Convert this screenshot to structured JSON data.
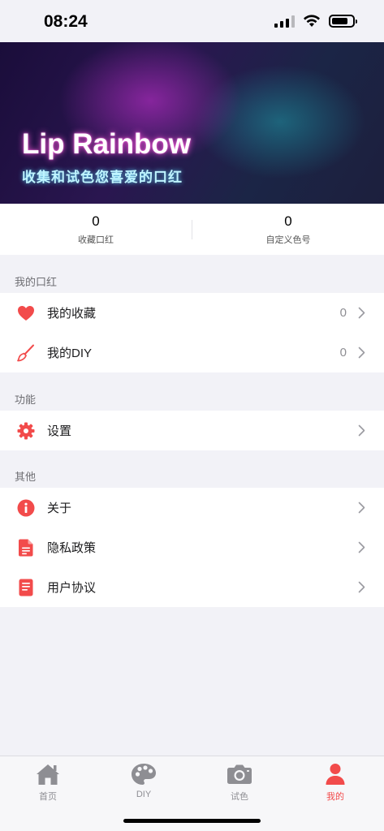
{
  "status_bar": {
    "time": "08:24"
  },
  "hero": {
    "title": "Lip Rainbow",
    "subtitle": "收集和试色您喜爱的口红"
  },
  "stats": [
    {
      "value": "0",
      "label": "收藏口红"
    },
    {
      "value": "0",
      "label": "自定义色号"
    }
  ],
  "sections": [
    {
      "header": "我的口红",
      "items": [
        {
          "label": "我的收藏",
          "value": "0",
          "icon": "heart-icon"
        },
        {
          "label": "我的DIY",
          "value": "0",
          "icon": "brush-icon"
        }
      ]
    },
    {
      "header": "功能",
      "items": [
        {
          "label": "设置",
          "icon": "gear-icon"
        }
      ]
    },
    {
      "header": "其他",
      "items": [
        {
          "label": "关于",
          "icon": "info-icon"
        },
        {
          "label": "隐私政策",
          "icon": "document-icon"
        },
        {
          "label": "用户协议",
          "icon": "agreement-icon"
        }
      ]
    }
  ],
  "tab_bar": {
    "tabs": [
      {
        "label": "首页",
        "icon": "home-icon"
      },
      {
        "label": "DIY",
        "icon": "palette-icon"
      },
      {
        "label": "试色",
        "icon": "camera-icon"
      },
      {
        "label": "我的",
        "icon": "person-icon",
        "active": true
      }
    ]
  },
  "colors": {
    "accent": "#f24b4b",
    "inactive": "#8e8e93",
    "background": "#f2f2f7"
  }
}
